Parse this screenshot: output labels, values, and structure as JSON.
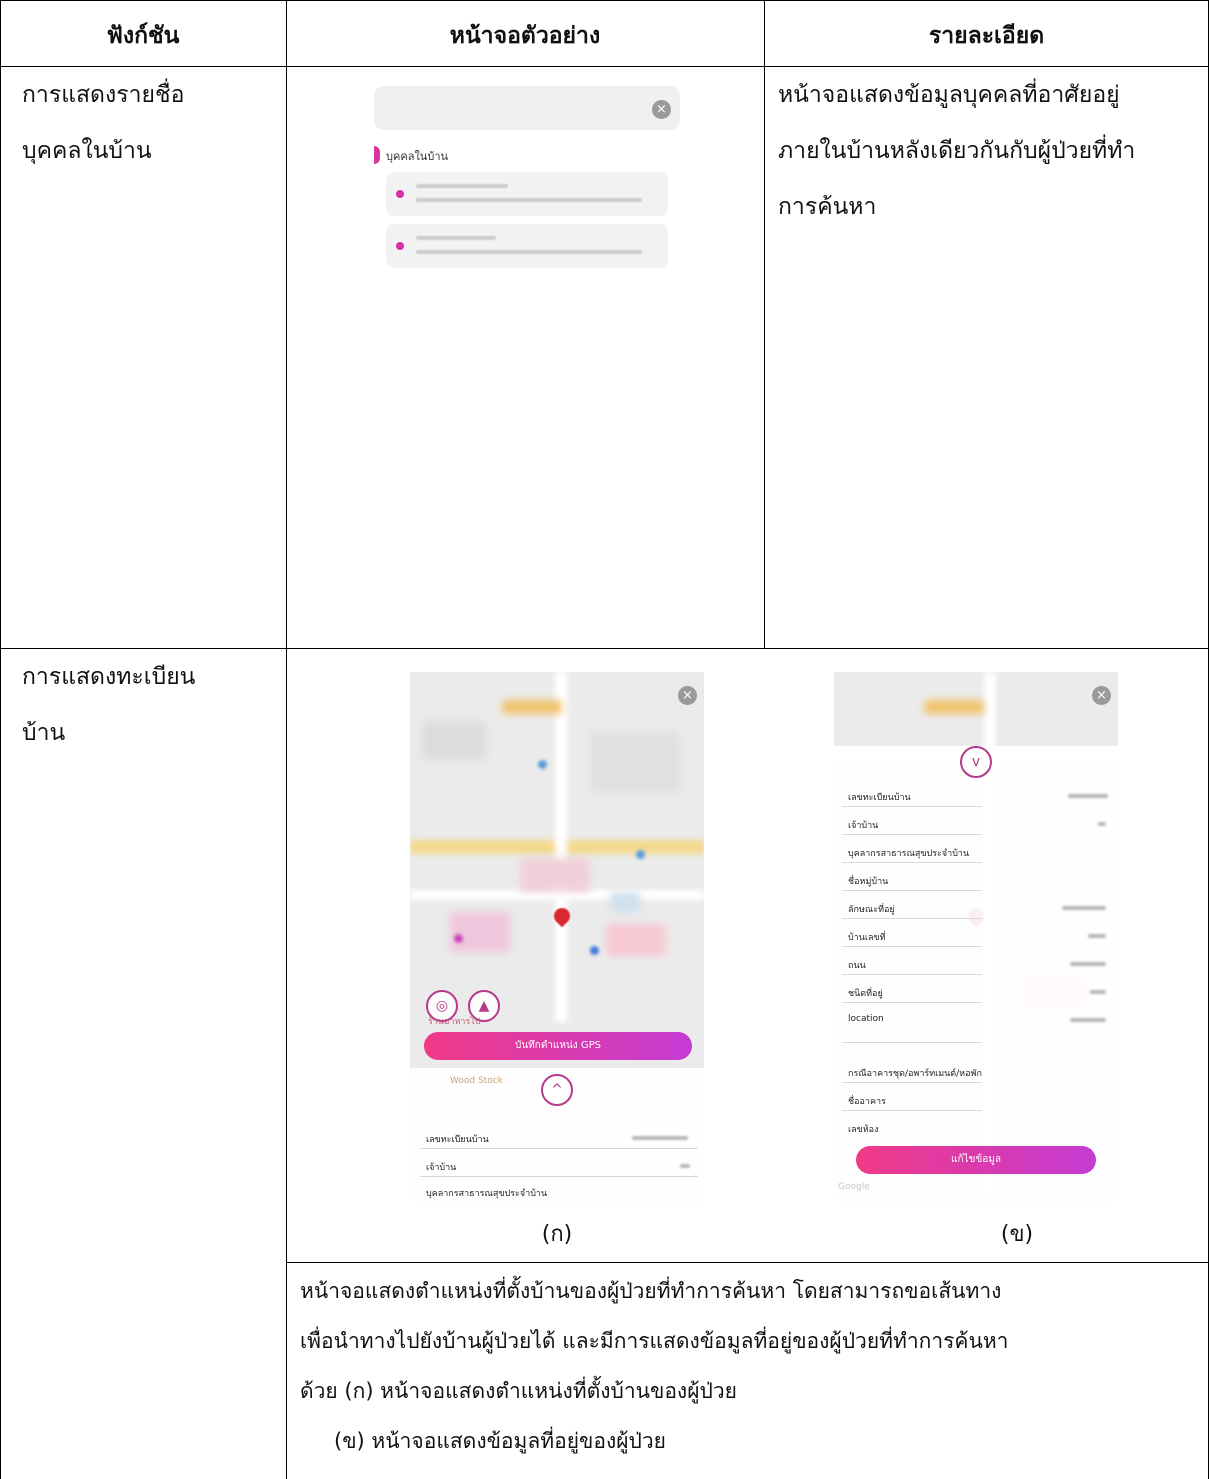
{
  "table": {
    "headers": {
      "function": "ฟังก์ชัน",
      "screen": "หน้าจอตัวอย่าง",
      "detail": "รายละเอียด"
    },
    "row1": {
      "function_lines": [
        "การแสดงรายชื่อ",
        "บุคคลในบ้าน"
      ],
      "detail_lines": [
        "หน้าจอแสดงข้อมูลบุคคลที่อาศัยอยู่",
        "ภายในบ้านหลังเดียวกันกับผู้ป่วยที่ทำ",
        "การค้นหา"
      ]
    },
    "row2": {
      "function_lines": [
        "การแสดงทะเบียน",
        "บ้าน"
      ],
      "caption_a": "(ก)",
      "caption_b": "(ข)",
      "detail_lines": [
        "หน้าจอแสดงตำแหน่งที่ตั้งบ้านของผู้ป่วยที่ทำการค้นหา โดยสามารถขอเส้นทาง",
        "เพื่อนำทางไปยังบ้านผู้ป่วยได้ และมีการแสดงข้อมูลที่อยู่ของผู้ป่วยที่ทำการค้นหา",
        "ด้วย (ก) หน้าจอแสดงตำแหน่งที่ตั้งบ้านของผู้ป่วย",
        "(ข) หน้าจอแสดงข้อมูลที่อยู่ของผู้ป่วย"
      ]
    }
  },
  "screen_person_list": {
    "section_label": "บุคคลในบ้าน",
    "close_icon": "×"
  },
  "screen_map_a": {
    "close_icon": "×",
    "gps_button": "บันทึกตำแหน่ง GPS",
    "expand_icon": "^",
    "store_label": "ร้านอาหารไป",
    "woodstock_label": "Wood Stock",
    "fields": [
      "เลขทะเบียนบ้าน",
      "เจ้าบ้าน",
      "บุคลากรสาธารณสุขประจำบ้าน"
    ]
  },
  "screen_map_b": {
    "close_icon": "×",
    "collapse_icon": "v",
    "edit_button": "แก้ไขข้อมูล",
    "google": "Google",
    "fields": [
      "เลขทะเบียนบ้าน",
      "เจ้าบ้าน",
      "บุคลากรสาธารณสุขประจำบ้าน",
      "ชื่อหมู่บ้าน",
      "ลักษณะที่อยู่",
      "บ้านเลขที่",
      "ถนน",
      "ชนิดที่อยู่",
      "location",
      "กรณีอาคารชุด/อพาร์ทเมนต์/หอพัก",
      "ชื่ออาคาร",
      "เลขห้อง"
    ]
  },
  "colors": {
    "accent_pink": "#f03a86",
    "accent_purple": "#c43bd4",
    "marker_magenta": "#d42fa8"
  }
}
